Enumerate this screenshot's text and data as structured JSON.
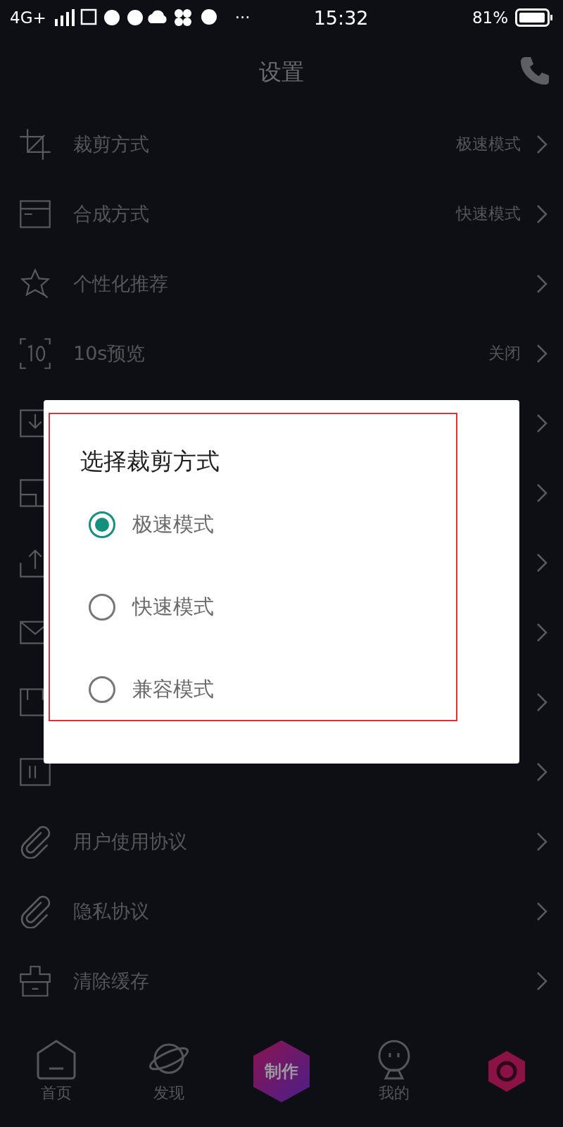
{
  "status_bar": {
    "network": "4G+",
    "more": "···",
    "time": "15:32",
    "battery": "81%"
  },
  "header": {
    "title": "设置"
  },
  "rows": [
    {
      "kind": "setting",
      "label": "裁剪方式",
      "value": "极速模式"
    },
    {
      "kind": "setting",
      "label": "合成方式",
      "value": "快速模式"
    },
    {
      "kind": "setting",
      "label": "个性化推荐"
    },
    {
      "kind": "setting",
      "label": "10s预览",
      "value": "关闭"
    },
    {
      "kind": "covered"
    },
    {
      "kind": "covered"
    },
    {
      "kind": "covered"
    },
    {
      "kind": "covered"
    },
    {
      "kind": "covered"
    },
    {
      "kind": "covered"
    },
    {
      "kind": "setting",
      "label": "用户使用协议"
    },
    {
      "kind": "setting",
      "label": "隐私协议"
    },
    {
      "kind": "setting",
      "label": "清除缓存"
    }
  ],
  "dialog": {
    "title": "选择裁剪方式",
    "highlighted": true,
    "options": [
      {
        "label": "极速模式",
        "selected": true
      },
      {
        "label": "快速模式",
        "selected": false
      },
      {
        "label": "兼容模式",
        "selected": false
      }
    ]
  },
  "tab_bar": [
    {
      "kind": "home",
      "label": "首页"
    },
    {
      "kind": "discover",
      "label": "发现"
    },
    {
      "kind": "create",
      "label": "制作"
    },
    {
      "kind": "me",
      "label": "我的"
    },
    {
      "kind": "hex"
    }
  ]
}
